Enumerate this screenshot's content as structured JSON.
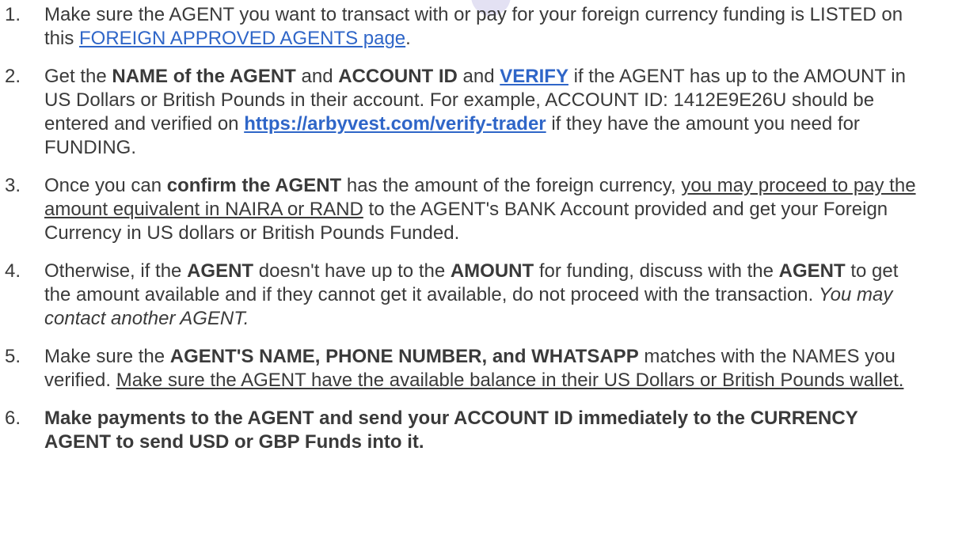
{
  "steps": [
    {
      "num": "1.",
      "t1": "Make sure the AGENT you want to transact with or pay for your foreign currency funding is LISTED on this ",
      "link": "FOREIGN APPROVED AGENTS page",
      "t2": "."
    },
    {
      "num": "2.",
      "t1": "Get the ",
      "b1": "NAME of the AGENT",
      "t2": " and ",
      "b2": "ACCOUNT ID",
      "t3": " and ",
      "link1": "VERIFY",
      "t4": " if the AGENT has up to the AMOUNT in US Dollars or British Pounds in their account. For example, ACCOUNT ID: 1412E9E26U should be entered and verified on ",
      "link2": "https://arbyvest.com/verify-trader",
      "t5": " if they have the amount you need for FUNDING."
    },
    {
      "num": "3.",
      "t1": "Once you can ",
      "b1": "confirm the AGENT",
      "t2": " has the amount of the foreign currency, ",
      "u1": "you may proceed to pay the amount equivalent in NAIRA or RAND",
      "t3": " to the AGENT's BANK Account provided and get your Foreign Currency in US dollars or British Pounds Funded."
    },
    {
      "num": "4.",
      "t1": "Otherwise, if the ",
      "b1": "AGENT",
      "t2": " doesn't have up to the ",
      "b2": "AMOUNT",
      "t3": " for funding, discuss with the ",
      "b3": "AGENT",
      "t4": " to get the amount available and if they cannot get it available, do not proceed with the transaction. ",
      "i1": "You may contact another AGENT."
    },
    {
      "num": "5.",
      "t1": "Make sure the ",
      "b1": "AGENT'S NAME, PHONE NUMBER, and WHATSAPP",
      "t2": " matches with the NAMES you verified. ",
      "u1": "Make sure the AGENT have the available balance in their US Dollars or British Pounds wallet."
    },
    {
      "num": "6.",
      "b1": "Make payments to the AGENT and send your ACCOUNT ID immediately to the CURRENCY AGENT to send USD or GBP Funds into it."
    }
  ]
}
